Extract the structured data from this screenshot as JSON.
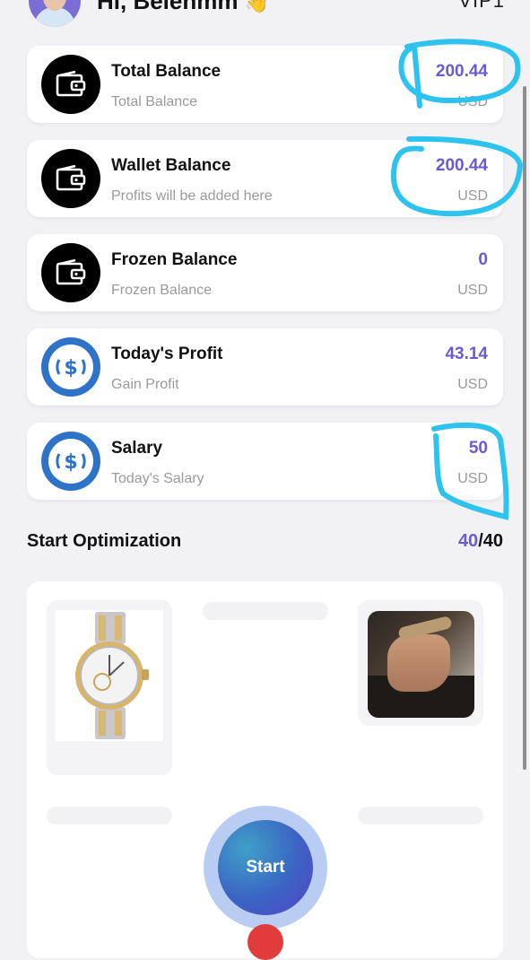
{
  "header": {
    "greeting": "Hi, Belenmm",
    "wave_emoji": "👋",
    "vip_label": "VIP1"
  },
  "cards": [
    {
      "title": "Total Balance",
      "subtitle": "Total Balance",
      "value": "200.44",
      "unit": "USD",
      "icon": "wallet-icon"
    },
    {
      "title": "Wallet Balance",
      "subtitle": "Profits will be added here",
      "value": "200.44",
      "unit": "USD",
      "icon": "wallet-icon"
    },
    {
      "title": "Frozen Balance",
      "subtitle": "Frozen Balance",
      "value": "0",
      "unit": "USD",
      "icon": "wallet-icon"
    },
    {
      "title": "Today's Profit",
      "subtitle": "Gain Profit",
      "value": "43.14",
      "unit": "USD",
      "icon": "usdc-icon"
    },
    {
      "title": "Salary",
      "subtitle": "Today's Salary",
      "value": "50",
      "unit": "USD",
      "icon": "usdc-icon"
    }
  ],
  "optimization": {
    "title": "Start Optimization",
    "done": "40",
    "separator": "/",
    "total": "40"
  },
  "start_button": {
    "label": "Start"
  },
  "colors": {
    "accent": "#6a5bd0",
    "annotation": "#2ec3ef",
    "usdc_blue": "#2f73c9"
  }
}
